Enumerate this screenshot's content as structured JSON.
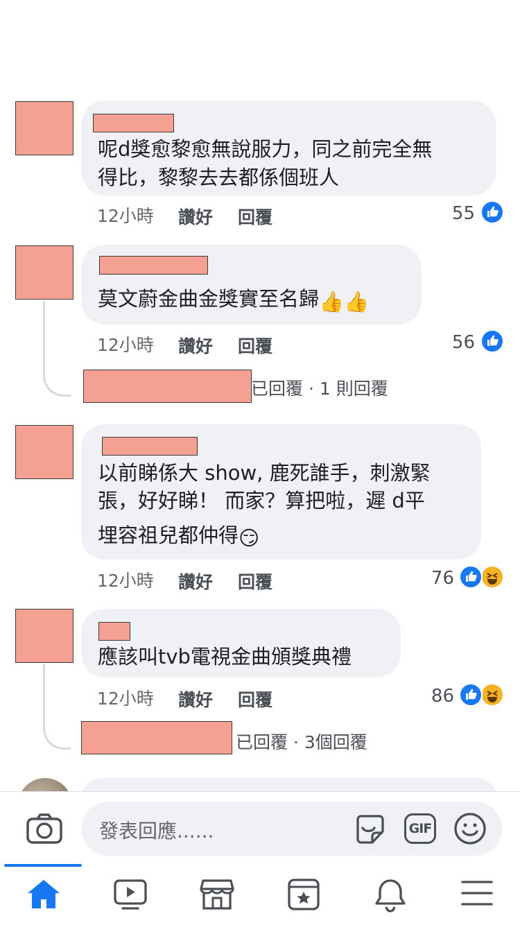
{
  "comments": [
    {
      "text_lines": [
        "呢d獎愈黎愈無說服力，同之前完全無",
        "得比，黎黎去去都係個班人"
      ],
      "time": "12小時",
      "like_label": "讚好",
      "reply_label": "回覆",
      "reaction_count": "55",
      "reactions": [
        "like"
      ]
    },
    {
      "text_lines": [
        "莫文蔚金曲金獎實至名歸"
      ],
      "text_emoji": "👍👍",
      "time": "12小時",
      "like_label": "讚好",
      "reply_label": "回覆",
      "reaction_count": "56",
      "reactions": [
        "like"
      ],
      "reply_summary": "已回覆 · 1 則回覆"
    },
    {
      "text_lines": [
        "以前睇係大 show, 鹿死誰手，刺激緊",
        "張，好好睇！ 而家？算把啦，遲 d平",
        "埋容祖兒都仲得"
      ],
      "text_emoji": "😏",
      "time": "12小時",
      "like_label": "讚好",
      "reply_label": "回覆",
      "reaction_count": "76",
      "reactions": [
        "like",
        "haha"
      ]
    },
    {
      "text_lines": [
        "應該叫tvb電視金曲頒獎典禮"
      ],
      "time": "12小時",
      "like_label": "讚好",
      "reply_label": "回覆",
      "reaction_count": "86",
      "reactions": [
        "like",
        "haha"
      ],
      "reply_summary": "已回覆 · 3個回覆"
    }
  ],
  "composer": {
    "placeholder": "發表回應......",
    "icons": [
      "camera-icon",
      "sticker-icon",
      "gif-icon",
      "emoji-icon"
    ],
    "gif_label": "GIF"
  },
  "tabbar": {
    "tabs": [
      "home-icon",
      "video-icon",
      "marketplace-icon",
      "news-icon",
      "notifications-icon",
      "menu-icon"
    ],
    "active": "home-icon"
  },
  "colors": {
    "accent": "#1877f2",
    "bubble": "#eff1f4",
    "redaction": "#f4a093",
    "haha": "#f7b125"
  }
}
